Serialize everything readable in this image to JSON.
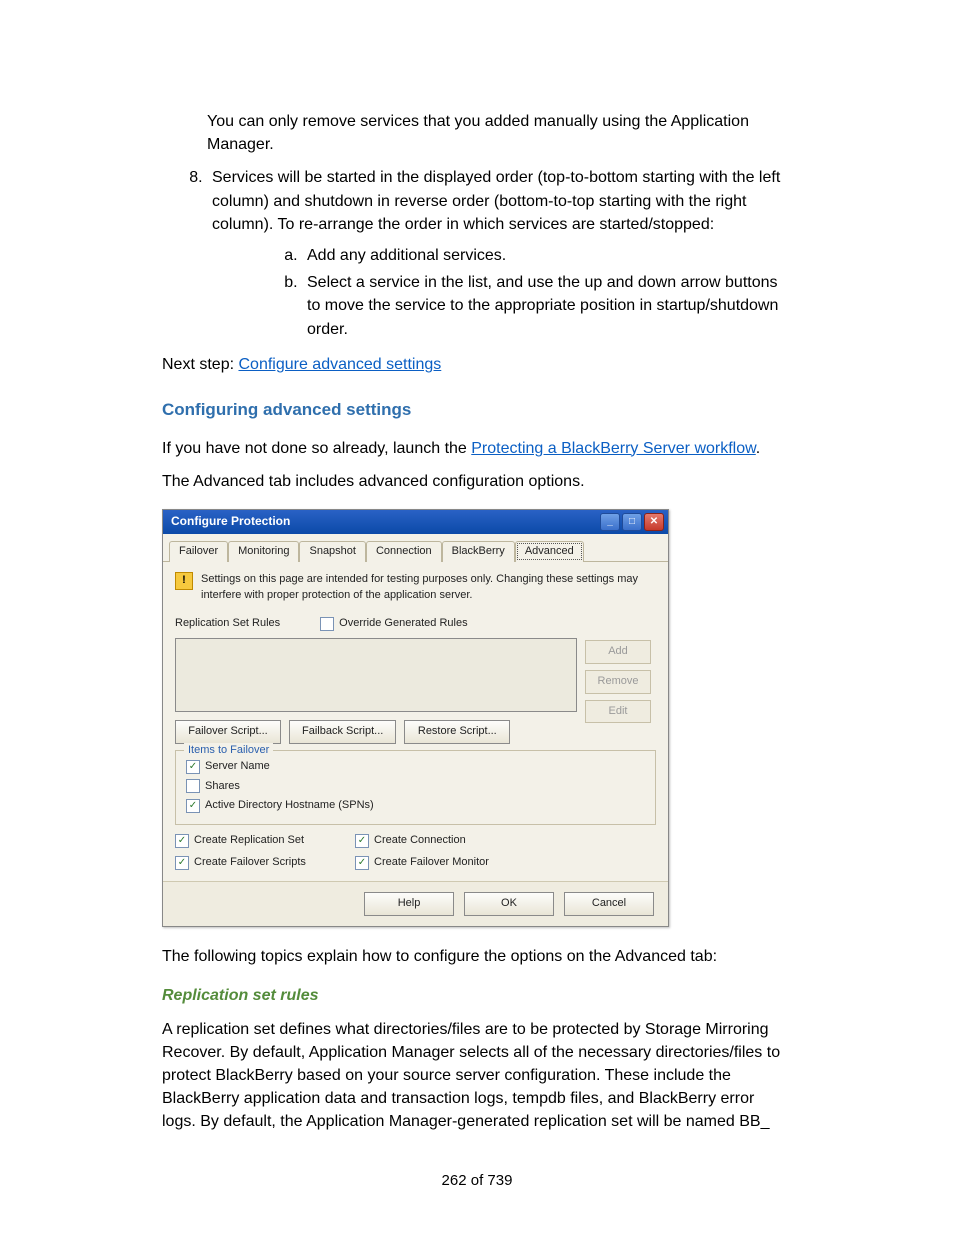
{
  "intro_note": "You can only remove services that you added manually using the Application Manager.",
  "step8": "Services will be started in the displayed order (top-to-bottom starting with the left column) and shutdown in reverse order (bottom-to-top starting with the right column). To re-arrange the order in which services are started/stopped:",
  "step8_a": "Add any additional services.",
  "step8_b": "Select a service in the list, and use the up and down arrow buttons to move the service to the appropriate position in startup/shutdown order.",
  "next_label": "Next step: ",
  "next_link": "Configure advanced settings",
  "heading": "Configuring advanced settings",
  "launch_pre": "If you have not done so already, launch the ",
  "launch_link": "Protecting a BlackBerry Server workflow",
  "launch_post": ".",
  "advanced_line": "The Advanced tab includes advanced configuration options.",
  "dialog": {
    "title": "Configure Protection",
    "tabs": [
      "Failover",
      "Monitoring",
      "Snapshot",
      "Connection",
      "BlackBerry",
      "Advanced"
    ],
    "warning": "Settings on this page are intended for testing purposes only.  Changing these settings may interfere with proper protection of the application server.",
    "rules_label": "Replication Set Rules",
    "override_label": "Override Generated Rules",
    "btn_add": "Add",
    "btn_remove": "Remove",
    "btn_edit": "Edit",
    "btn_failover": "Failover Script...",
    "btn_failback": "Failback Script...",
    "btn_restore": "Restore Script...",
    "group_title": "Items to Failover",
    "item_servername": "Server Name",
    "item_shares": "Shares",
    "item_spns": "Active Directory Hostname (SPNs)",
    "create_repl": "Create Replication Set",
    "create_conn": "Create Connection",
    "create_scripts": "Create Failover Scripts",
    "create_monitor": "Create Failover Monitor",
    "footer_help": "Help",
    "footer_ok": "OK",
    "footer_cancel": "Cancel"
  },
  "following": "The following topics explain how to configure the options on the Advanced tab:",
  "subheading": "Replication set rules",
  "bodypara": "A replication set defines what directories/files are to be protected by Storage Mirroring Recover. By default, Application Manager selects all of the necessary directories/files to protect BlackBerry based on your source server configuration. These include the BlackBerry application data and transaction logs, tempdb files, and BlackBerry error logs. By default, the Application Manager-generated replication set will be named BB_",
  "page_number": "262 of 739"
}
